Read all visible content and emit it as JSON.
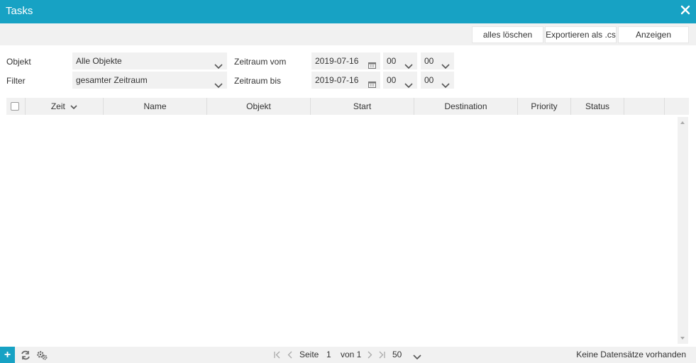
{
  "window": {
    "title": "Tasks"
  },
  "toolbar": {
    "clear_all": "alles löschen",
    "export_csv": "Exportieren als .cs",
    "show": "Anzeigen"
  },
  "filters": {
    "object_label": "Objekt",
    "object_value": "Alle Objekte",
    "filter_label": "Filter",
    "filter_value": "gesamter Zeitraum",
    "from_label": "Zeitraum vom",
    "from_date": "2019-07-16",
    "from_hour": "00",
    "from_minute": "00",
    "to_label": "Zeitraum bis",
    "to_date": "2019-07-16",
    "to_hour": "00",
    "to_minute": "00"
  },
  "grid": {
    "columns": [
      "Zeit",
      "Name",
      "Objekt",
      "Start",
      "Destination",
      "Priority",
      "Status"
    ],
    "sort_column": "Zeit",
    "rows": []
  },
  "pager": {
    "page_label": "Seite",
    "page": "1",
    "of_label": "von 1",
    "page_size": "50"
  },
  "status": {
    "empty_message": "Keine Datensätze vorhanden"
  },
  "colors": {
    "accent": "#17a2c4",
    "panel": "#f1f1f1"
  }
}
